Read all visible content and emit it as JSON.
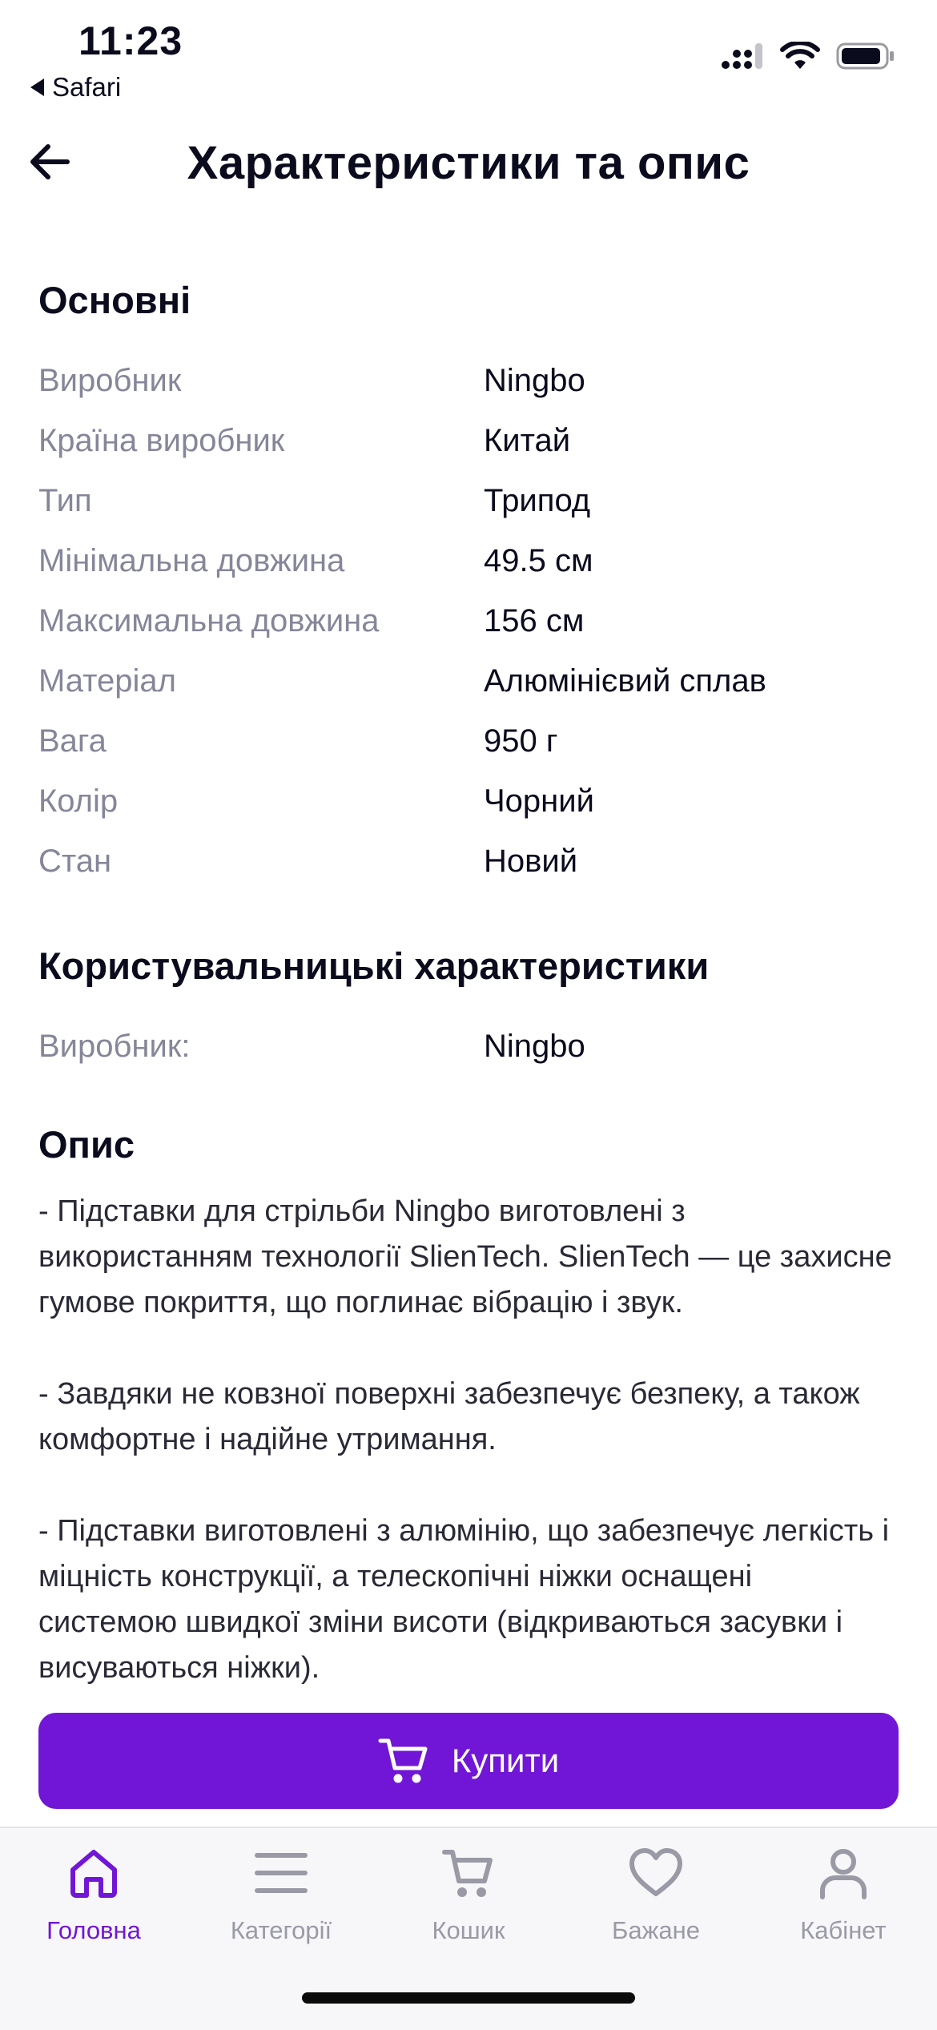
{
  "status_bar": {
    "time": "11:23",
    "back_app": "Safari",
    "icons": [
      "signal-icon",
      "wifi-icon",
      "battery-icon"
    ]
  },
  "header": {
    "title": "Характеристики та опис",
    "back_icon": "back-arrow-icon"
  },
  "main_section": {
    "title": "Основні",
    "rows": [
      {
        "label": "Виробник",
        "value": "Ningbo"
      },
      {
        "label": "Країна виробник",
        "value": "Китай"
      },
      {
        "label": "Тип",
        "value": "Трипод"
      },
      {
        "label": "Мінімальна довжина",
        "value": "49.5 см"
      },
      {
        "label": "Максимальна довжина",
        "value": "156 см"
      },
      {
        "label": "Матеріал",
        "value": "Алюмінієвий сплав"
      },
      {
        "label": "Вага",
        "value": "950 г"
      },
      {
        "label": "Колір",
        "value": "Чорний"
      },
      {
        "label": "Стан",
        "value": "Новий"
      }
    ]
  },
  "user_section": {
    "title": "Користувальницькі характеристики",
    "rows": [
      {
        "label": "Виробник:",
        "value": "Ningbo"
      }
    ]
  },
  "description": {
    "title": "Опис",
    "text": "- Підставки для стрільби Ningbo виготовлені з використанням технології SlienTech. SlienTech — це захисне гумове покриття, що поглинає вібрацію і звук.\n\n- Завдяки не ковзної поверхні забезпечує безпеку, а також комфортне і надійне утримання.\n\n- Підставки виготовлені з алюмінію, що забезпечує легкість і міцність конструкції, а телескопічні ніжки оснащені системою швидкої зміни висоти (відкриваються засувки і висуваються ніжки)."
  },
  "buy_button": {
    "label": "Купити",
    "icon": "cart-icon"
  },
  "tab_bar": {
    "active": "home",
    "tabs": [
      {
        "id": "home",
        "label": "Головна",
        "icon": "home-icon"
      },
      {
        "id": "categories",
        "label": "Категорії",
        "icon": "menu-icon"
      },
      {
        "id": "cart",
        "label": "Кошик",
        "icon": "cart-icon"
      },
      {
        "id": "wishlist",
        "label": "Бажане",
        "icon": "heart-icon"
      },
      {
        "id": "account",
        "label": "Кабінет",
        "icon": "user-icon"
      }
    ]
  },
  "colors": {
    "accent": "#7116d6",
    "label_gray": "#86869a",
    "text_dark": "#0b0b1e",
    "tab_inactive": "#9a9aa6"
  }
}
